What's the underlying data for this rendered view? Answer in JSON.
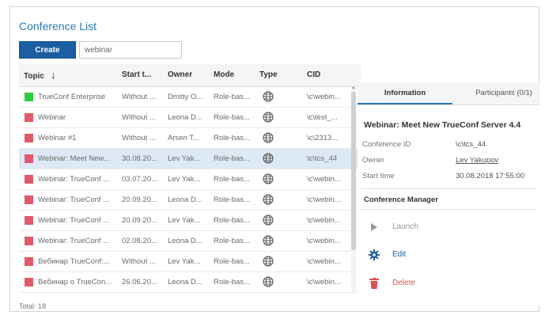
{
  "title": "Conference List",
  "toolbar": {
    "create_label": "Create",
    "search_value": "webinar"
  },
  "columns": [
    "Topic",
    "Start t...",
    "Owner",
    "Mode",
    "Type",
    "CID"
  ],
  "colors": {
    "green": "#2ecc40",
    "red": "#e05a6b",
    "accent": "#1a5ea3",
    "selected": "#dde9f5"
  },
  "rows": [
    {
      "status": "green",
      "topic": "TrueConf Enterprise",
      "start": "Without ...",
      "owner": "Dmitiy O...",
      "mode": "Role-bas...",
      "cid": "\\c\\webin..."
    },
    {
      "status": "red",
      "topic": "Webinar",
      "start": "Without ...",
      "owner": "Leona D...",
      "mode": "Role-bas...",
      "cid": "\\c\\test_..."
    },
    {
      "status": "red",
      "topic": "Webinar #1",
      "start": "Without ...",
      "owner": "Arsen T...",
      "mode": "Role-bas...",
      "cid": "\\c\\2313..."
    },
    {
      "status": "red",
      "topic": "Webinar: Meet New...",
      "start": "30.08.20...",
      "owner": "Lev Yak...",
      "mode": "Role-bas...",
      "cid": "\\c\\tcs_44",
      "selected": true
    },
    {
      "status": "red",
      "topic": "Webinar: TrueConf ...",
      "start": "03.07.20...",
      "owner": "Lev Yak...",
      "mode": "Role-bas...",
      "cid": "\\c\\webin..."
    },
    {
      "status": "red",
      "topic": "Webinar: TrueConf ...",
      "start": "20.09.20...",
      "owner": "Leona D...",
      "mode": "Role-bas...",
      "cid": "\\c\\webin..."
    },
    {
      "status": "red",
      "topic": "Webinar: TrueConf ...",
      "start": "20.09.20...",
      "owner": "Lev Yak...",
      "mode": "Role-bas...",
      "cid": "\\c\\webin..."
    },
    {
      "status": "red",
      "topic": "Webinar: TrueConf ...",
      "start": "02.08.20...",
      "owner": "Leona D...",
      "mode": "Role-bas...",
      "cid": "\\c\\webin..."
    },
    {
      "status": "red",
      "topic": "Вебинар TrueConf:...",
      "start": "Without ...",
      "owner": "Lev Yak...",
      "mode": "Role-bas...",
      "cid": "\\c\\webin..."
    },
    {
      "status": "red",
      "topic": "Вебинар о TrueCon...",
      "start": "26.06.20...",
      "owner": "Leona D...",
      "mode": "Role-bas...",
      "cid": "\\c\\webin..."
    }
  ],
  "row_type_icon": "globe-icon",
  "total": "Total: 18",
  "panel": {
    "tabs": [
      "Information",
      "Participants (0/1)"
    ],
    "conference_title": "Webinar: Meet New TrueConf Server 4.4",
    "fields": [
      {
        "label": "Conference ID",
        "value": "\\c\\tcs_44"
      },
      {
        "label": "Owner",
        "value": "Lev Yakupov"
      },
      {
        "label": "Start time",
        "value": "30.08.2018 17:55:00"
      }
    ],
    "section_title": "Conference Manager",
    "actions": {
      "launch": "Launch",
      "edit": "Edit",
      "delete": "Delete"
    }
  }
}
